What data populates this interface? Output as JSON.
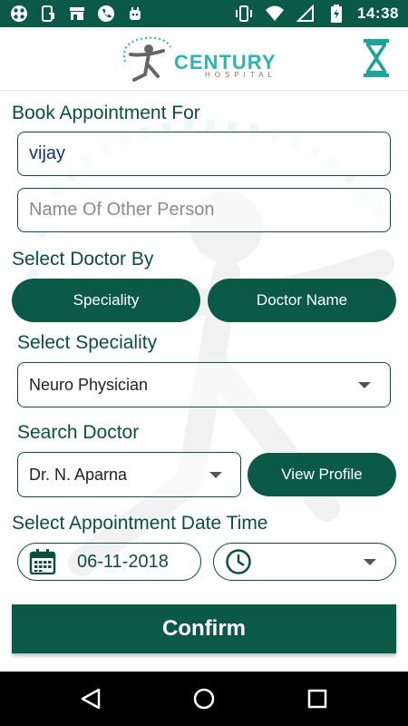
{
  "status_bar": {
    "time": "14:38",
    "left_icons": [
      "app-grid-icon",
      "screen-rotate-icon",
      "store-icon",
      "phone-icon",
      "android-icon"
    ],
    "right_icons": [
      "vibrate-icon",
      "wifi-icon",
      "signal-icon",
      "battery-icon"
    ]
  },
  "header": {
    "brand": "CENTURY",
    "brand_sub": "HOSPITAL",
    "hourglass_icon": "hourglass-icon"
  },
  "form": {
    "book_for_label": "Book Appointment For",
    "patient_name_value": "vijay",
    "other_person_placeholder": "Name Of Other Person",
    "select_doctor_by_label": "Select Doctor By",
    "speciality_button": "Speciality",
    "doctor_name_button": "Doctor Name",
    "select_speciality_label": "Select Speciality",
    "speciality_value": "Neuro Physician",
    "search_doctor_label": "Search Doctor",
    "doctor_value": "Dr. N. Aparna",
    "view_profile_button": "View Profile",
    "date_time_label": "Select Appointment Date Time",
    "date_value": "06-11-2018",
    "confirm_button": "Confirm"
  },
  "nav_bar": {
    "icons": [
      "back-icon",
      "home-icon",
      "recents-icon"
    ]
  },
  "colors": {
    "primary": "#0a5a47",
    "label": "#0a4f40",
    "brand_teal": "#2bb6b2"
  }
}
